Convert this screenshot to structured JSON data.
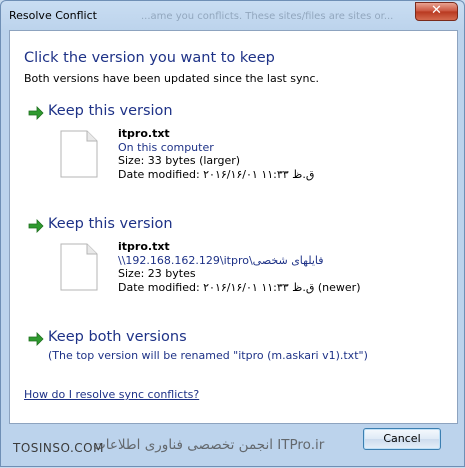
{
  "window": {
    "title": "Resolve Conflict",
    "title_ghost": "...ame you conflicts. These sites/files are sites or...",
    "close_glyph": "✕"
  },
  "dialog": {
    "heading": "Click the version you want to keep",
    "subheading": "Both versions have been updated since the last sync."
  },
  "options": [
    {
      "label": "Keep this version",
      "file_name": "itpro.txt",
      "location": "On this computer",
      "size": "Size: 33 bytes (larger)",
      "date": "Date modified: ۲۰۱۶/۱۶/۰۱ ق.ظ ۱۱:۳۳"
    },
    {
      "label": "Keep this version",
      "file_name": "itpro.txt",
      "location": "\\\\192.168.162.129\\itpro\\فایلهای شخصی",
      "size": "Size: 23 bytes",
      "date": "Date modified: ۲۰۱۶/۱۶/۰۱ ق.ظ ۱۱:۳۳ (newer)"
    },
    {
      "label": "Keep both versions",
      "note": "(The top version will be renamed \"itpro (m.askari v1).txt\")"
    }
  ],
  "help_link": "How do I resolve sync conflicts?",
  "footer": {
    "watermark_left": "TOSINSO.COM",
    "watermark_text": "انجمن تخصصی فناوری اطلاعات ITPro.ir",
    "cancel_label": "Cancel"
  },
  "colors": {
    "link_blue": "#1e3287",
    "arrow_green": "#2f9a2f",
    "titlebar_blue": "#bcd3ec"
  },
  "icons": [
    "close-icon",
    "green-arrow-icon",
    "text-file-icon"
  ]
}
